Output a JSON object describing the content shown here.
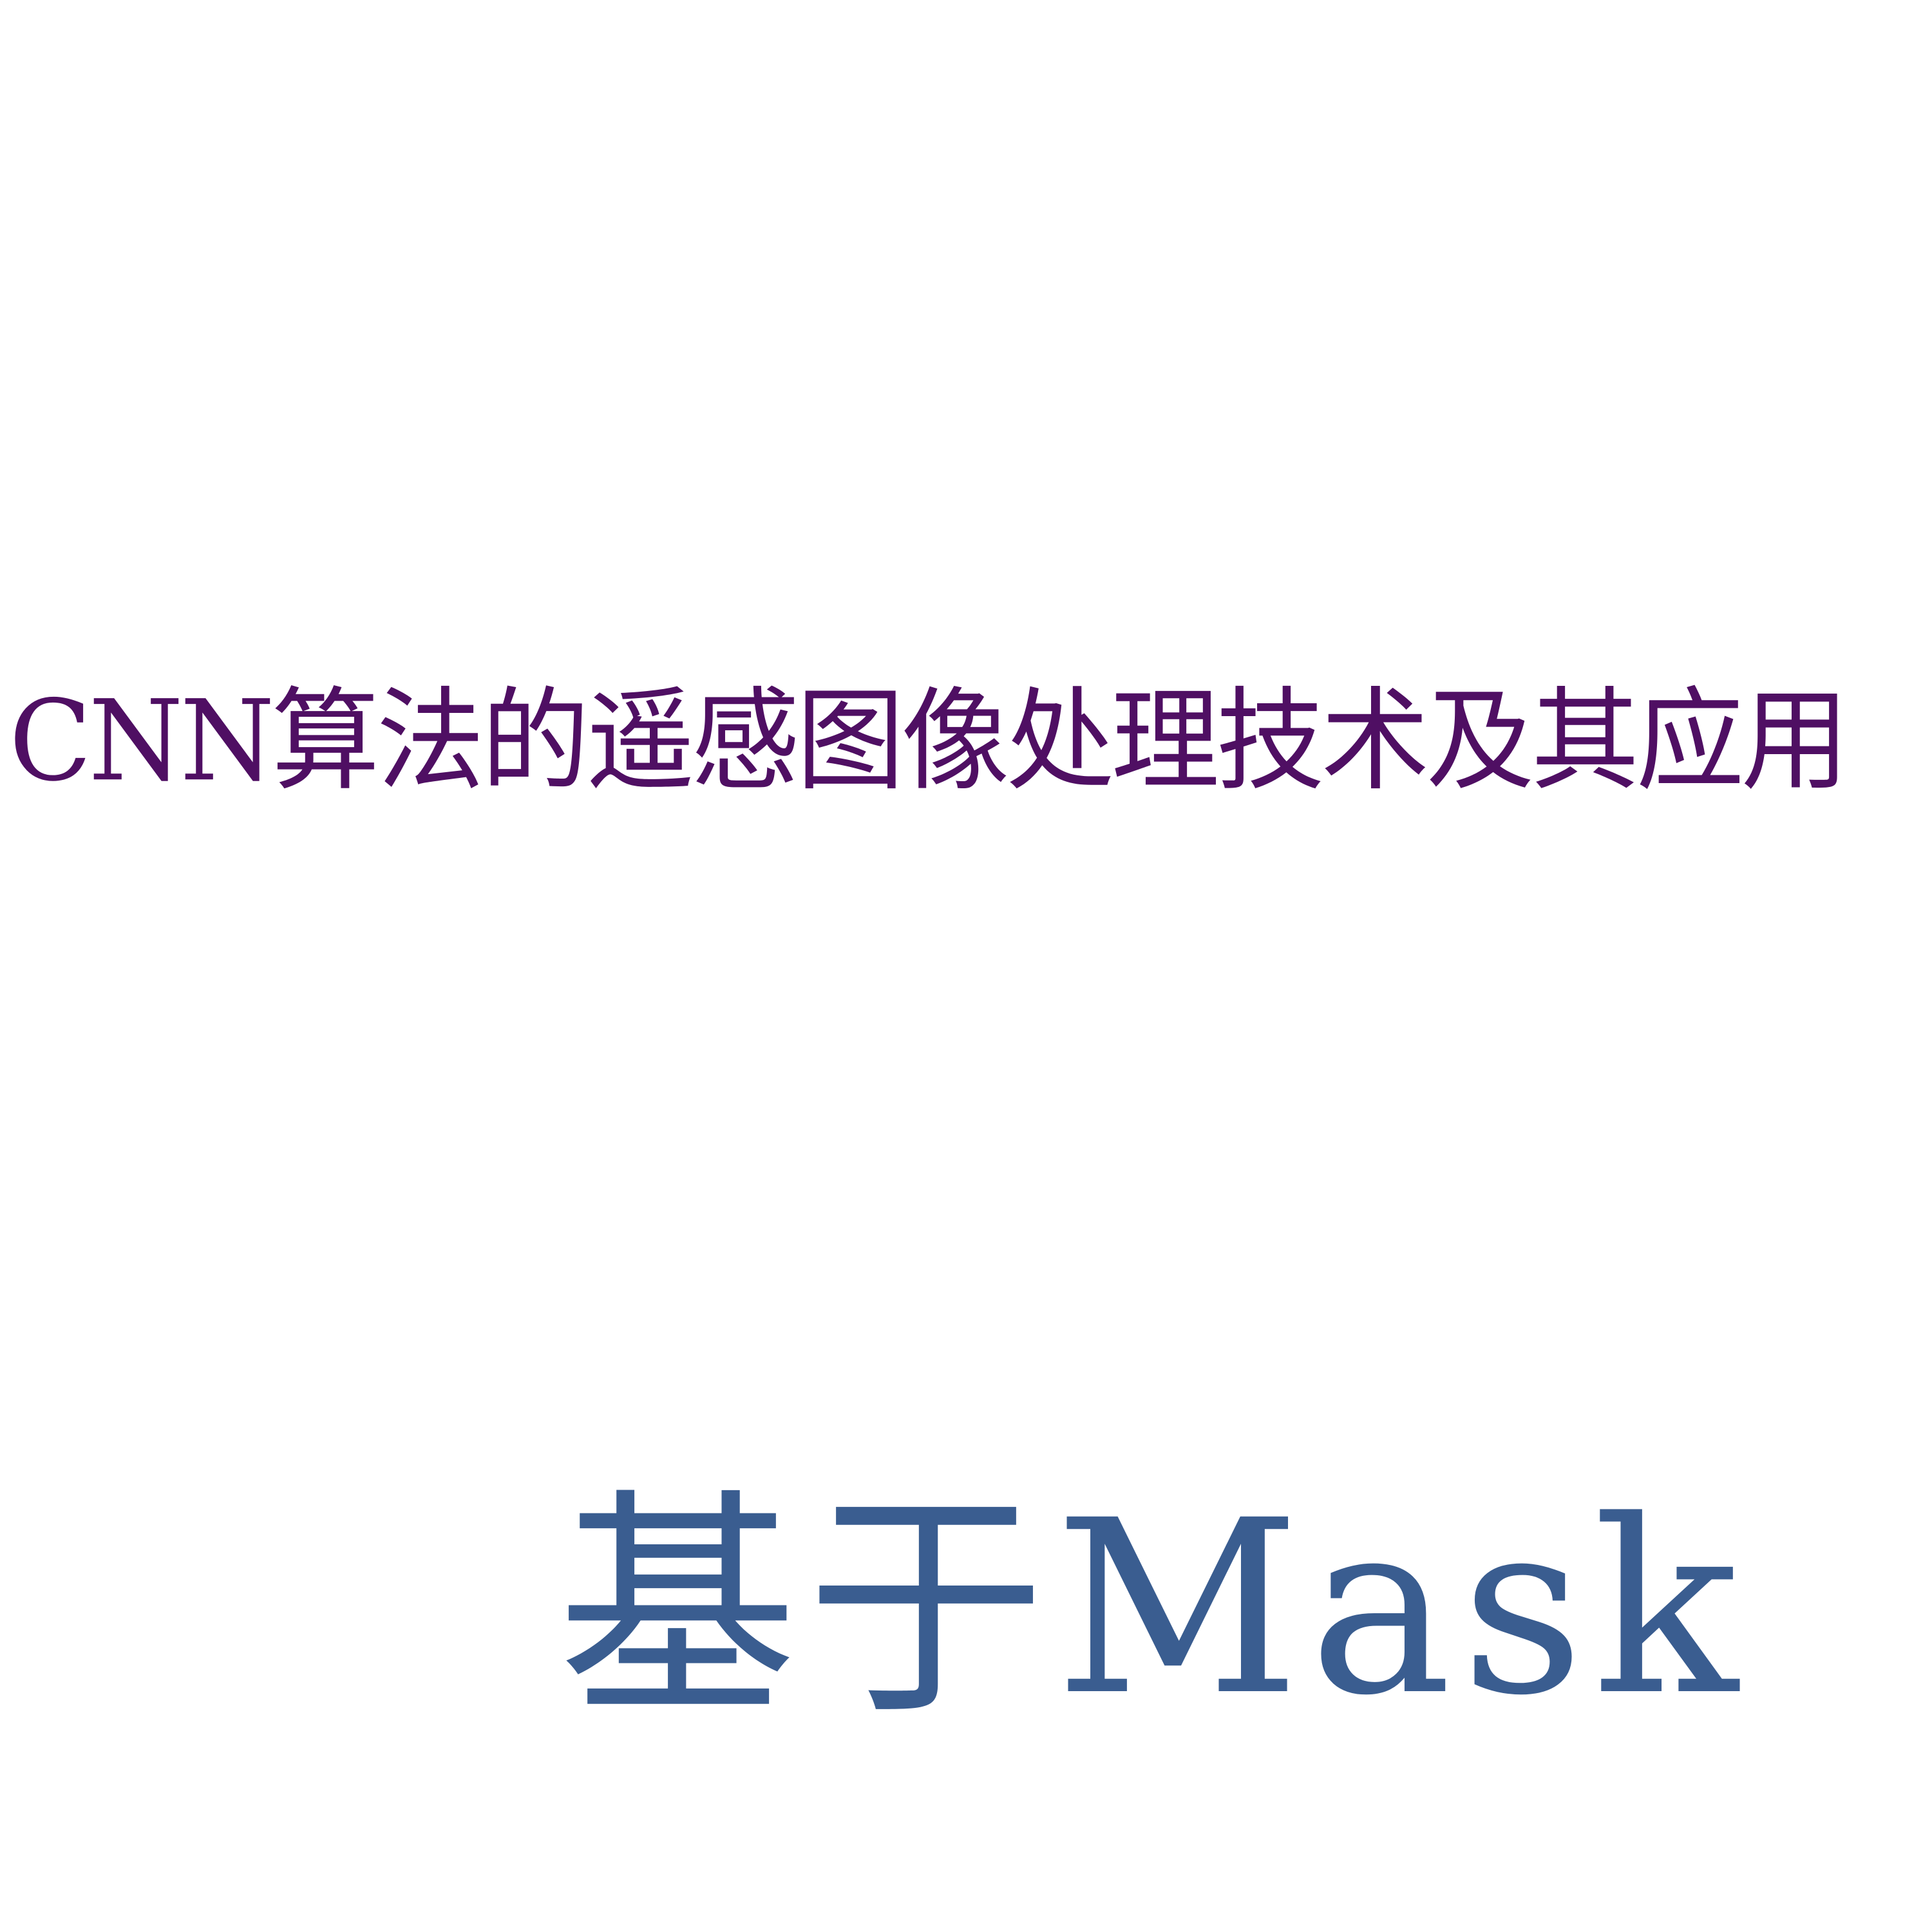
{
  "document": {
    "line_1": "CNN算法的遥感图像处理技术及其应用",
    "line_2": "基于Mask"
  },
  "colors": {
    "background": "#ffffff",
    "line_1": "#4f0f63",
    "line_2": "#3a5d90"
  }
}
